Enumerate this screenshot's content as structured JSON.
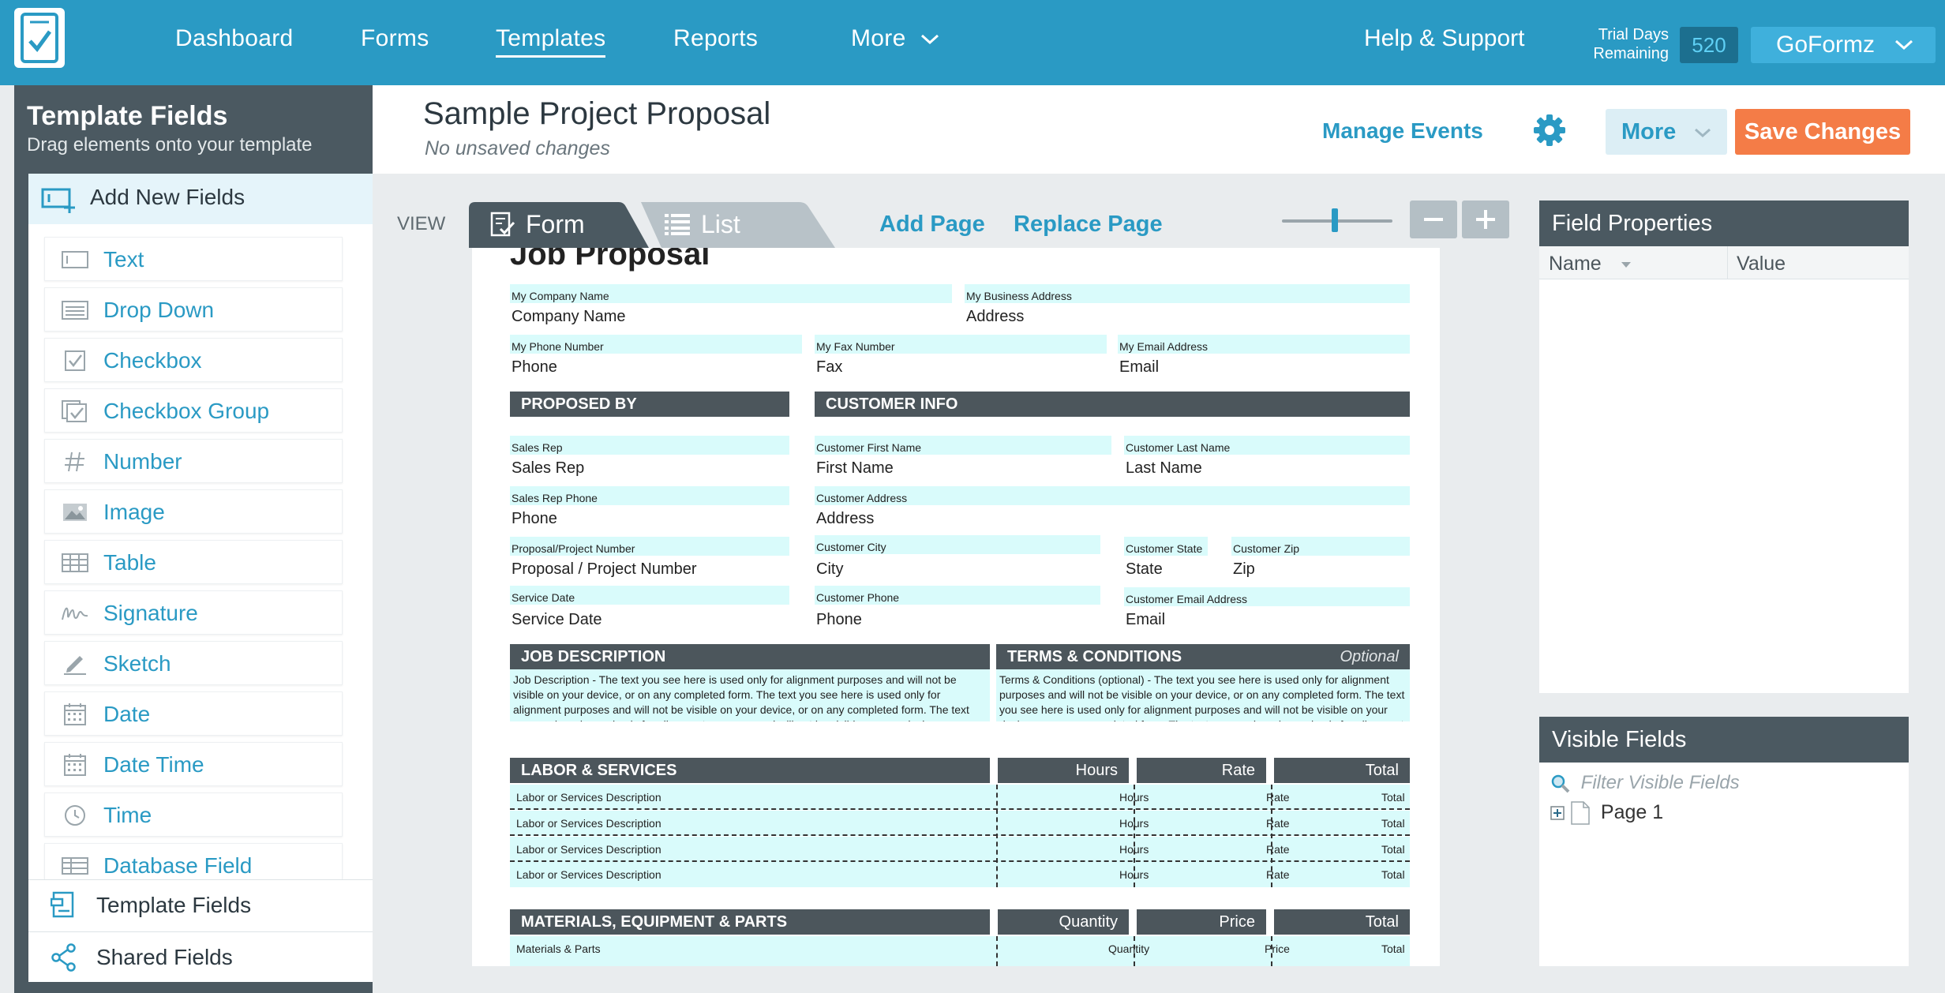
{
  "nav": {
    "items": [
      "Dashboard",
      "Forms",
      "Templates",
      "Reports",
      "More"
    ],
    "active": "Templates",
    "help": "Help & Support",
    "trial_label": "Trial Days Remaining",
    "trial_count": "520",
    "account": "GoFormz"
  },
  "sidebar": {
    "title": "Template Fields",
    "subtitle": "Drag elements onto your template",
    "add_new": "Add New Fields",
    "fields": [
      "Text",
      "Drop Down",
      "Checkbox",
      "Checkbox Group",
      "Number",
      "Image",
      "Table",
      "Signature",
      "Sketch",
      "Date",
      "Date Time",
      "Time",
      "Database Field"
    ],
    "bottom": [
      "Template Fields",
      "Shared Fields"
    ]
  },
  "template": {
    "title": "Sample Project Proposal",
    "status": "No unsaved changes",
    "manage_events": "Manage Events",
    "more": "More",
    "save": "Save Changes"
  },
  "canvas": {
    "view_label": "VIEW",
    "tab_form": "Form",
    "tab_list": "List",
    "add_page": "Add Page",
    "replace_page": "Replace Page",
    "zoom_level": 0.48
  },
  "form": {
    "title": "Job Proposal",
    "company_name_cap": "My Company Name",
    "company_name_val": "Company Name",
    "business_addr_cap": "My Business Address",
    "business_addr_val": "Address",
    "phone_cap": "My Phone Number",
    "phone_val": "Phone",
    "fax_cap": "My Fax Number",
    "fax_val": "Fax",
    "email_cap": "My Email Address",
    "email_val": "Email",
    "proposed_by": "PROPOSED BY",
    "customer_info": "CUSTOMER INFO",
    "sales_rep_cap": "Sales Rep",
    "sales_rep_val": "Sales Rep",
    "first_name_cap": "Customer First Name",
    "first_name_val": "First Name",
    "last_name_cap": "Customer Last Name",
    "last_name_val": "Last Name",
    "rep_phone_cap": "Sales Rep Phone",
    "rep_phone_val": "Phone",
    "cust_addr_cap": "Customer Address",
    "cust_addr_val": "Address",
    "proposal_cap": "Proposal/Project Number",
    "proposal_val": "Proposal / Project Number",
    "city_cap": "Customer City",
    "city_val": "City",
    "state_cap": "Customer State",
    "state_val": "State",
    "zip_cap": "Customer Zip",
    "zip_val": "Zip",
    "service_date_cap": "Service Date",
    "service_date_val": "Service Date",
    "cust_phone_cap": "Customer Phone",
    "cust_phone_val": "Phone",
    "cust_email_cap": "Customer Email Address",
    "cust_email_val": "Email",
    "job_desc_head": "JOB DESCRIPTION",
    "job_desc_text": "Job Description - The text you see here is used only for alignment purposes and will not be visible on your device, or on any completed form. The text you see here is used only for alignment purposes and will not be visible on your device, or on any completed form. The text you see here is used only for alignment purposes and will not be visible on your device, or on",
    "terms_head": "TERMS & CONDITIONS",
    "terms_optional": "Optional",
    "terms_text": "Terms & Conditions (optional) - The text you see here is used only for alignment purposes and will not be visible on your device, or on any completed form. The text you see here is used only for alignment purposes and will not be visible on your device, or on any completed form. The text you see here is used only for alignment purposes and will not be visible on your device, or on any completed",
    "labor_head": "LABOR & SERVICES",
    "labor_cols": [
      "Hours",
      "Rate",
      "Total"
    ],
    "labor_rows": [
      [
        "Labor or Services Description",
        "Hours",
        "Rate",
        "Total"
      ],
      [
        "Labor or Services Description",
        "Hours",
        "Rate",
        "Total"
      ],
      [
        "Labor or Services Description",
        "Hours",
        "Rate",
        "Total"
      ],
      [
        "Labor or Services Description",
        "Hours",
        "Rate",
        "Total"
      ]
    ],
    "materials_head": "MATERIALS, EQUIPMENT & PARTS",
    "materials_cols": [
      "Quantity",
      "Price",
      "Total"
    ],
    "materials_rows": [
      [
        "Materials & Parts",
        "Quantity",
        "Price",
        "Total"
      ]
    ]
  },
  "field_properties": {
    "title": "Field Properties",
    "col_name": "Name",
    "col_value": "Value"
  },
  "visible_fields": {
    "title": "Visible Fields",
    "filter_placeholder": "Filter Visible Fields",
    "tree": [
      "Page 1"
    ]
  },
  "colors": {
    "nav_bg": "#2a9ac4",
    "sidebar_bg": "#4b5961",
    "accent": "#2a9ac4",
    "save": "#f47c47",
    "field_fill": "#d9fbfb"
  }
}
